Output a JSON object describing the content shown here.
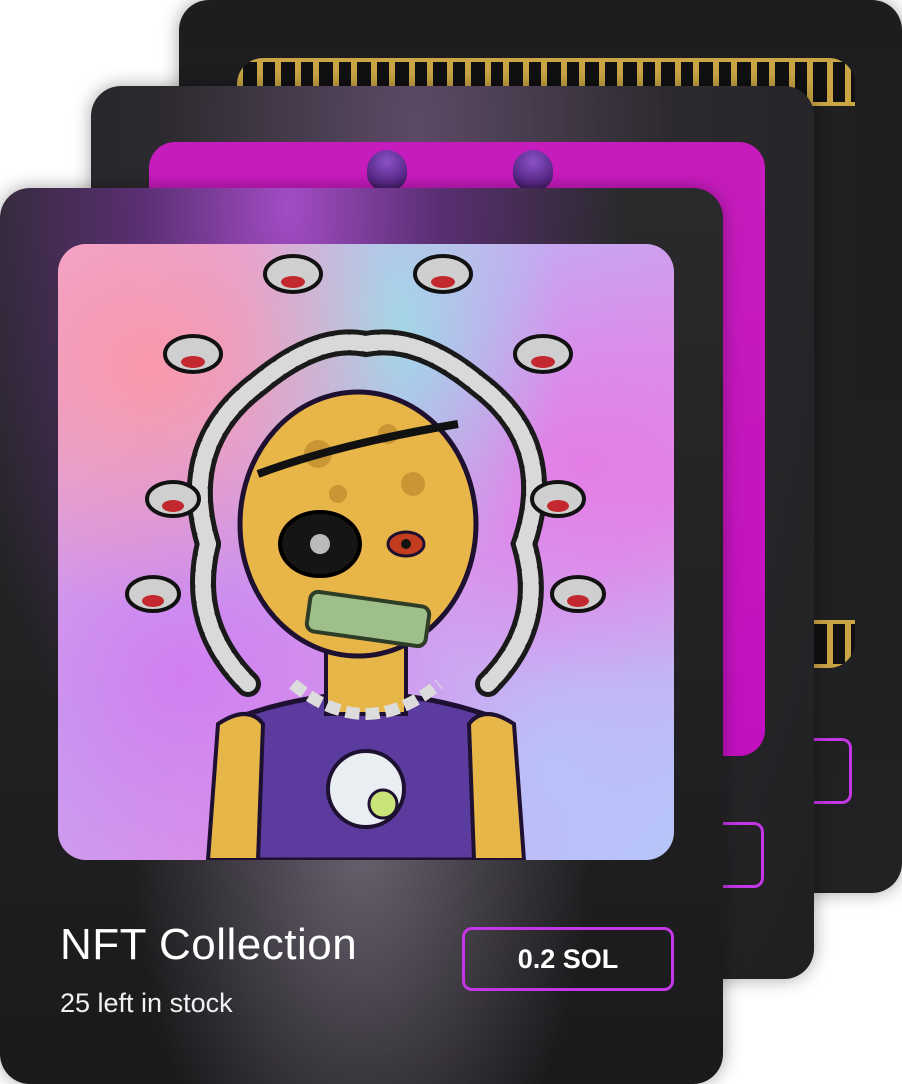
{
  "cards": {
    "front": {
      "title": "NFT Collection",
      "stock": "25 left in stock",
      "price": "0.2 SOL",
      "artwork": "medusa-character-nft-art"
    },
    "middle": {
      "artwork": "magenta-nft-art"
    },
    "back": {
      "artwork": "greek-marble-nft-art"
    }
  },
  "colors": {
    "accent": "#c437e6",
    "card_bg": "#1f1f21",
    "magenta_art": "#c210c0",
    "gold_trim": "#c9a545"
  }
}
